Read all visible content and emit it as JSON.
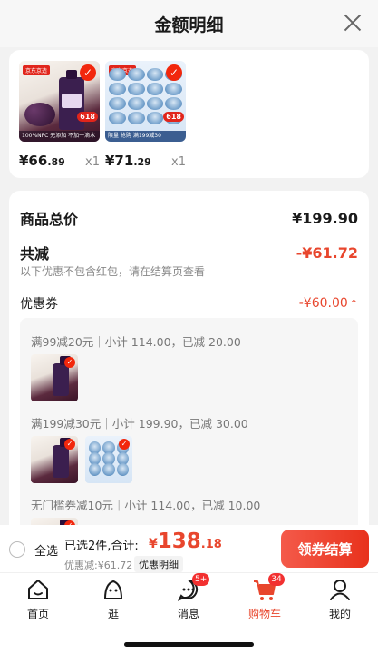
{
  "header": {
    "title": "金额明细"
  },
  "products": [
    {
      "price_int": "¥66",
      "price_dec": ".89",
      "qty": "x1",
      "badge": "618",
      "tag": "京东京造",
      "strip": "100%NFC 无添加 不加一滴水"
    },
    {
      "price_int": "¥71",
      "price_dec": ".29",
      "qty": "x1",
      "badge": "618",
      "tag": "京东京造",
      "strip": "限量 抢购 满199减30"
    }
  ],
  "summary": {
    "total_label": "商品总价",
    "total_value": "¥199.90",
    "discount_label": "共减",
    "discount_value": "-¥61.72",
    "note": "以下优惠不包含红包，请在结算页查看",
    "coupon_label": "优惠券",
    "coupon_value": "-¥60.00",
    "coupon_caret": "^"
  },
  "coupons": [
    {
      "text": "满99减20元｜小计 114.00，已减 20.00"
    },
    {
      "text": "满199减30元｜小计 199.90，已减 30.00"
    },
    {
      "text": "无门槛券减10元｜小计 114.00，已减 10.00"
    }
  ],
  "footer": {
    "select_all": "全选",
    "selected_info": "已选2件,合计:",
    "currency": "¥",
    "total_int": "138",
    "total_dec": ".18",
    "sub_info": "优惠减:¥61.72",
    "detail_link": "优惠明细",
    "checkout_label": "领券结算"
  },
  "tabs": [
    {
      "label": "首页",
      "icon": "home-icon"
    },
    {
      "label": "逛",
      "icon": "smile-bag-icon"
    },
    {
      "label": "消息",
      "icon": "message-icon",
      "badge": "5+"
    },
    {
      "label": "购物车",
      "icon": "cart-icon",
      "badge": "34",
      "active": true
    },
    {
      "label": "我的",
      "icon": "profile-icon"
    }
  ],
  "colors": {
    "accent": "#e8462d",
    "checkout": "#f2270c"
  }
}
